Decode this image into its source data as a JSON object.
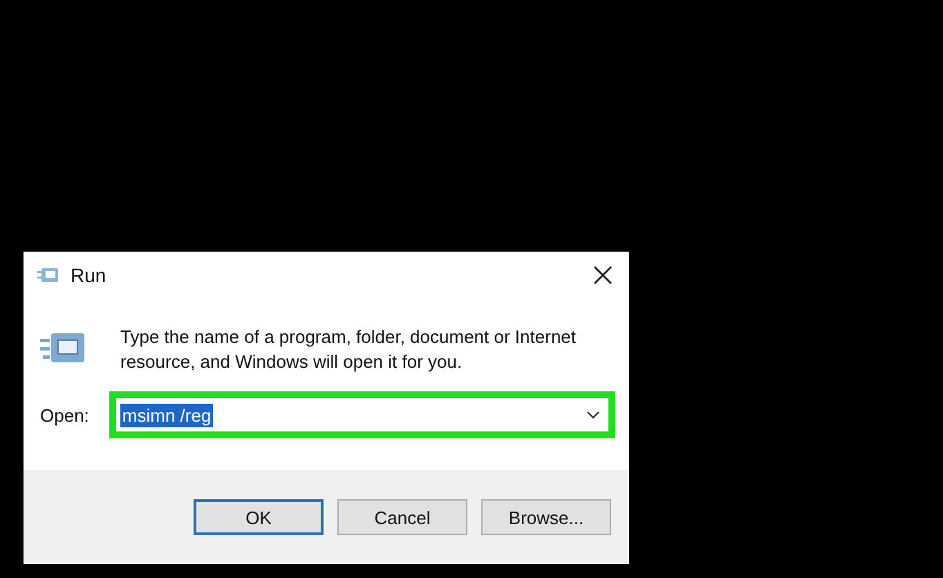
{
  "window": {
    "title": "Run"
  },
  "prompt": "Type the name of a program, folder, document or Internet resource, and Windows will open it for you.",
  "open_field": {
    "label": "Open:",
    "value": "msimn /reg",
    "value_selected": true,
    "highlighted": true
  },
  "buttons": [
    {
      "label": "OK",
      "default": true
    },
    {
      "label": "Cancel",
      "default": false
    },
    {
      "label": "Browse...",
      "default": false
    }
  ]
}
